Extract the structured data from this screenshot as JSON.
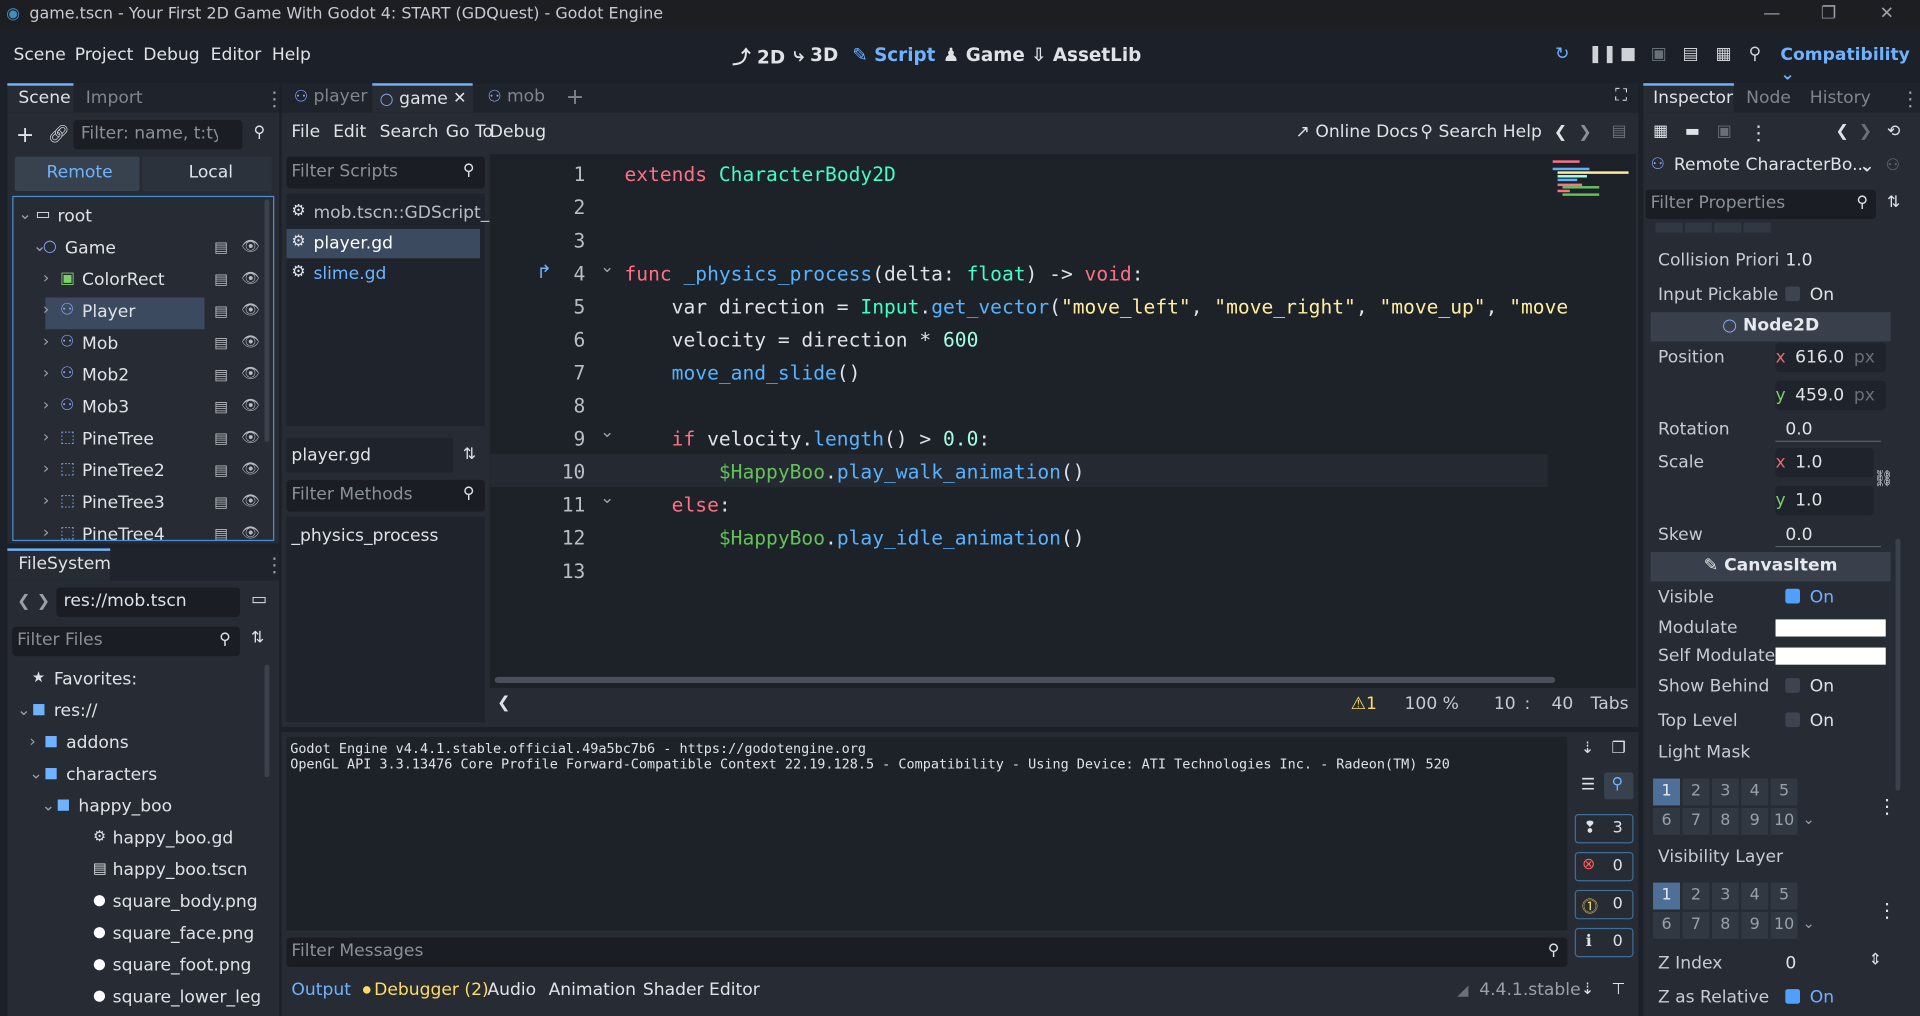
{
  "titlebar": {
    "title": "game.tscn - Your First 2D Game With Godot 4: START (GDQuest) - Godot Engine"
  },
  "menu": {
    "items": [
      "Scene",
      "Project",
      "Debug",
      "Editor",
      "Help"
    ]
  },
  "workspaces": [
    {
      "label": "2D",
      "icon": "2d-icon"
    },
    {
      "label": "3D",
      "icon": "3d-icon"
    },
    {
      "label": "Script",
      "icon": "script-icon",
      "active": true
    },
    {
      "label": "Game",
      "icon": "game-icon"
    },
    {
      "label": "AssetLib",
      "icon": "assetlib-icon"
    }
  ],
  "renderer": "Compatibility",
  "scene_dock": {
    "tabs": [
      "Scene",
      "Import"
    ],
    "filter_placeholder": "Filter: name, t:typ",
    "modes": [
      "Remote",
      "Local"
    ],
    "nodes": [
      {
        "name": "root",
        "icon": "window-icon",
        "depth": 0
      },
      {
        "name": "Game",
        "icon": "node2d-icon",
        "depth": 1
      },
      {
        "name": "ColorRect",
        "icon": "colorrect-icon",
        "depth": 2
      },
      {
        "name": "Player",
        "icon": "characterbody-icon",
        "depth": 2,
        "selected": true
      },
      {
        "name": "Mob",
        "icon": "characterbody-icon",
        "depth": 2
      },
      {
        "name": "Mob2",
        "icon": "characterbody-icon",
        "depth": 2
      },
      {
        "name": "Mob3",
        "icon": "characterbody-icon",
        "depth": 2
      },
      {
        "name": "PineTree",
        "icon": "staticbody-icon",
        "depth": 2
      },
      {
        "name": "PineTree2",
        "icon": "staticbody-icon",
        "depth": 2
      },
      {
        "name": "PineTree3",
        "icon": "staticbody-icon",
        "depth": 2
      },
      {
        "name": "PineTree4",
        "icon": "staticbody-icon",
        "depth": 2
      }
    ]
  },
  "filesystem": {
    "title": "FileSystem",
    "path": "res://mob.tscn",
    "filter_placeholder": "Filter Files",
    "items": [
      {
        "name": "Favorites:",
        "icon": "star-icon",
        "depth": 0
      },
      {
        "name": "res://",
        "icon": "folder-icon",
        "depth": 0
      },
      {
        "name": "addons",
        "icon": "folder-icon",
        "depth": 1
      },
      {
        "name": "characters",
        "icon": "folder-icon",
        "depth": 1
      },
      {
        "name": "happy_boo",
        "icon": "folder-icon",
        "depth": 2
      },
      {
        "name": "happy_boo.gd",
        "icon": "gear-icon",
        "depth": 3
      },
      {
        "name": "happy_boo.tscn",
        "icon": "clapper-icon",
        "depth": 3
      },
      {
        "name": "square_body.png",
        "icon": "image-icon",
        "depth": 3
      },
      {
        "name": "square_face.png",
        "icon": "image-icon",
        "depth": 3
      },
      {
        "name": "square_foot.png",
        "icon": "image-icon",
        "depth": 3
      },
      {
        "name": "square_lower_leg.png",
        "icon": "image-icon",
        "depth": 3
      }
    ]
  },
  "editor_tabs": [
    {
      "label": "player",
      "icon": "characterbody-icon"
    },
    {
      "label": "game",
      "icon": "node2d-icon",
      "active": true,
      "closable": true
    },
    {
      "label": "mob",
      "icon": "characterbody-icon"
    }
  ],
  "script_menu": [
    "File",
    "Edit",
    "Search",
    "Go To",
    "Debug"
  ],
  "online_docs": "Online Docs",
  "search_help": "Search Help",
  "script_list": {
    "filter_placeholder": "Filter Scripts",
    "scripts": [
      {
        "name": "mob.tscn::GDScript_...",
        "selected": false
      },
      {
        "name": "player.gd",
        "selected": true
      },
      {
        "name": "slime.gd",
        "selected": false
      }
    ],
    "current": "player.gd",
    "methods_placeholder": "Filter Methods",
    "methods": [
      "_physics_process"
    ]
  },
  "code": [
    {
      "n": "1",
      "tokens": [
        [
          "kw",
          "extends"
        ],
        [
          "",
          "",
          " "
        ],
        [
          "ty",
          "CharacterBody2D"
        ]
      ]
    },
    {
      "n": "2",
      "tokens": []
    },
    {
      "n": "3",
      "tokens": []
    },
    {
      "n": "4",
      "tokens": [
        [
          "kw",
          "func"
        ],
        [
          "",
          "",
          " "
        ],
        [
          "fn",
          "_physics_process"
        ],
        [
          "",
          "",
          "(delta: "
        ],
        [
          "ty",
          "float"
        ],
        [
          "",
          "",
          ") -> "
        ],
        [
          "kw",
          "void"
        ],
        [
          "",
          "",
          ":"
        ]
      ]
    },
    {
      "n": "5",
      "tokens": [
        [
          "",
          "",
          "    var direction = "
        ],
        [
          "ty",
          "Input"
        ],
        [
          "",
          "",
          "."
        ],
        [
          "fn",
          "get_vector"
        ],
        [
          "",
          "",
          "("
        ],
        [
          "st",
          "\"move_left\""
        ],
        [
          "",
          "",
          ", "
        ],
        [
          "st",
          "\"move_right\""
        ],
        [
          "",
          "",
          ", "
        ],
        [
          "st",
          "\"move_up\""
        ],
        [
          "",
          "",
          ", "
        ],
        [
          "st",
          "\"move"
        ]
      ]
    },
    {
      "n": "6",
      "tokens": [
        [
          "",
          "",
          "    velocity = direction * "
        ],
        [
          "nm",
          "600"
        ]
      ]
    },
    {
      "n": "7",
      "tokens": [
        [
          "",
          "",
          "    "
        ],
        [
          "fn",
          "move_and_slide"
        ],
        [
          "",
          "",
          "()"
        ]
      ]
    },
    {
      "n": "8",
      "tokens": []
    },
    {
      "n": "9",
      "tokens": [
        [
          "",
          "",
          "    "
        ],
        [
          "kw",
          "if"
        ],
        [
          "",
          "",
          "",
          " velocity."
        ],
        [
          "fn",
          "length"
        ],
        [
          "",
          "",
          "() > "
        ],
        [
          "nm",
          "0.0"
        ],
        [
          "",
          "",
          ":"
        ]
      ]
    },
    {
      "n": "10",
      "tokens": [
        [
          "",
          "",
          "        "
        ],
        [
          "nd",
          "$HappyBoo"
        ],
        [
          "",
          "",
          "."
        ],
        [
          "fn",
          "play_walk_animation"
        ],
        [
          "",
          "",
          "()"
        ]
      ]
    },
    {
      "n": "11",
      "tokens": [
        [
          "",
          "",
          "    "
        ],
        [
          "kw",
          "else"
        ],
        [
          "",
          "",
          ":"
        ]
      ]
    },
    {
      "n": "12",
      "tokens": [
        [
          "",
          "",
          "        "
        ],
        [
          "nd",
          "$HappyBoo"
        ],
        [
          "",
          "",
          "."
        ],
        [
          "fn",
          "play_idle_animation"
        ],
        [
          "",
          "",
          "()"
        ]
      ]
    },
    {
      "n": "13",
      "tokens": []
    }
  ],
  "status": {
    "warnings": "1",
    "zoom": "100 %",
    "line": "10",
    "col": "40",
    "indent": "Tabs"
  },
  "output": {
    "lines": [
      "Godot Engine v4.4.1.stable.official.49a5bc7b6 - https://godotengine.org",
      "OpenGL API 3.3.13476 Core Profile Forward-Compatible Context 22.19.128.5 - Compatibility - Using Device: ATI Technologies Inc. - Radeon(TM) 520"
    ],
    "filter_placeholder": "Filter Messages",
    "counts": {
      "messages": "3",
      "errors": "0",
      "warnings": "0",
      "info": "0"
    }
  },
  "bottom_tabs": [
    "Output",
    "Debugger (2)",
    "Audio",
    "Animation",
    "Shader Editor"
  ],
  "version": "4.4.1.stable",
  "inspector": {
    "tabs": [
      "Inspector",
      "Node",
      "History"
    ],
    "object": "Remote CharacterBo...",
    "filter_placeholder": "Filter Properties",
    "collision_priority_label": "Collision Priori",
    "collision_priority": "1.0",
    "input_pickable_label": "Input Pickable",
    "on": "On",
    "node2d": "Node2D",
    "position_label": "Position",
    "pos_x": "616.0",
    "pos_y": "459.0",
    "px": "px",
    "x": "x",
    "y": "y",
    "rotation_label": "Rotation",
    "rotation": "0.0",
    "scale_label": "Scale",
    "scale_x": "1.0",
    "scale_y": "1.0",
    "skew_label": "Skew",
    "skew": "0.0",
    "canvasitem": "CanvasItem",
    "visible_label": "Visible",
    "modulate_label": "Modulate",
    "self_modulate_label": "Self Modulate",
    "show_behind_label": "Show Behind",
    "top_level_label": "Top Level",
    "light_mask_label": "Light Mask",
    "visibility_layer_label": "Visibility Layer",
    "z_index_label": "Z Index",
    "z_index": "0",
    "z_relative_label": "Z as Relative",
    "layers_row1": [
      "1",
      "2",
      "3",
      "4",
      "5"
    ],
    "layers_row2": [
      "6",
      "7",
      "8",
      "9",
      "10"
    ]
  }
}
